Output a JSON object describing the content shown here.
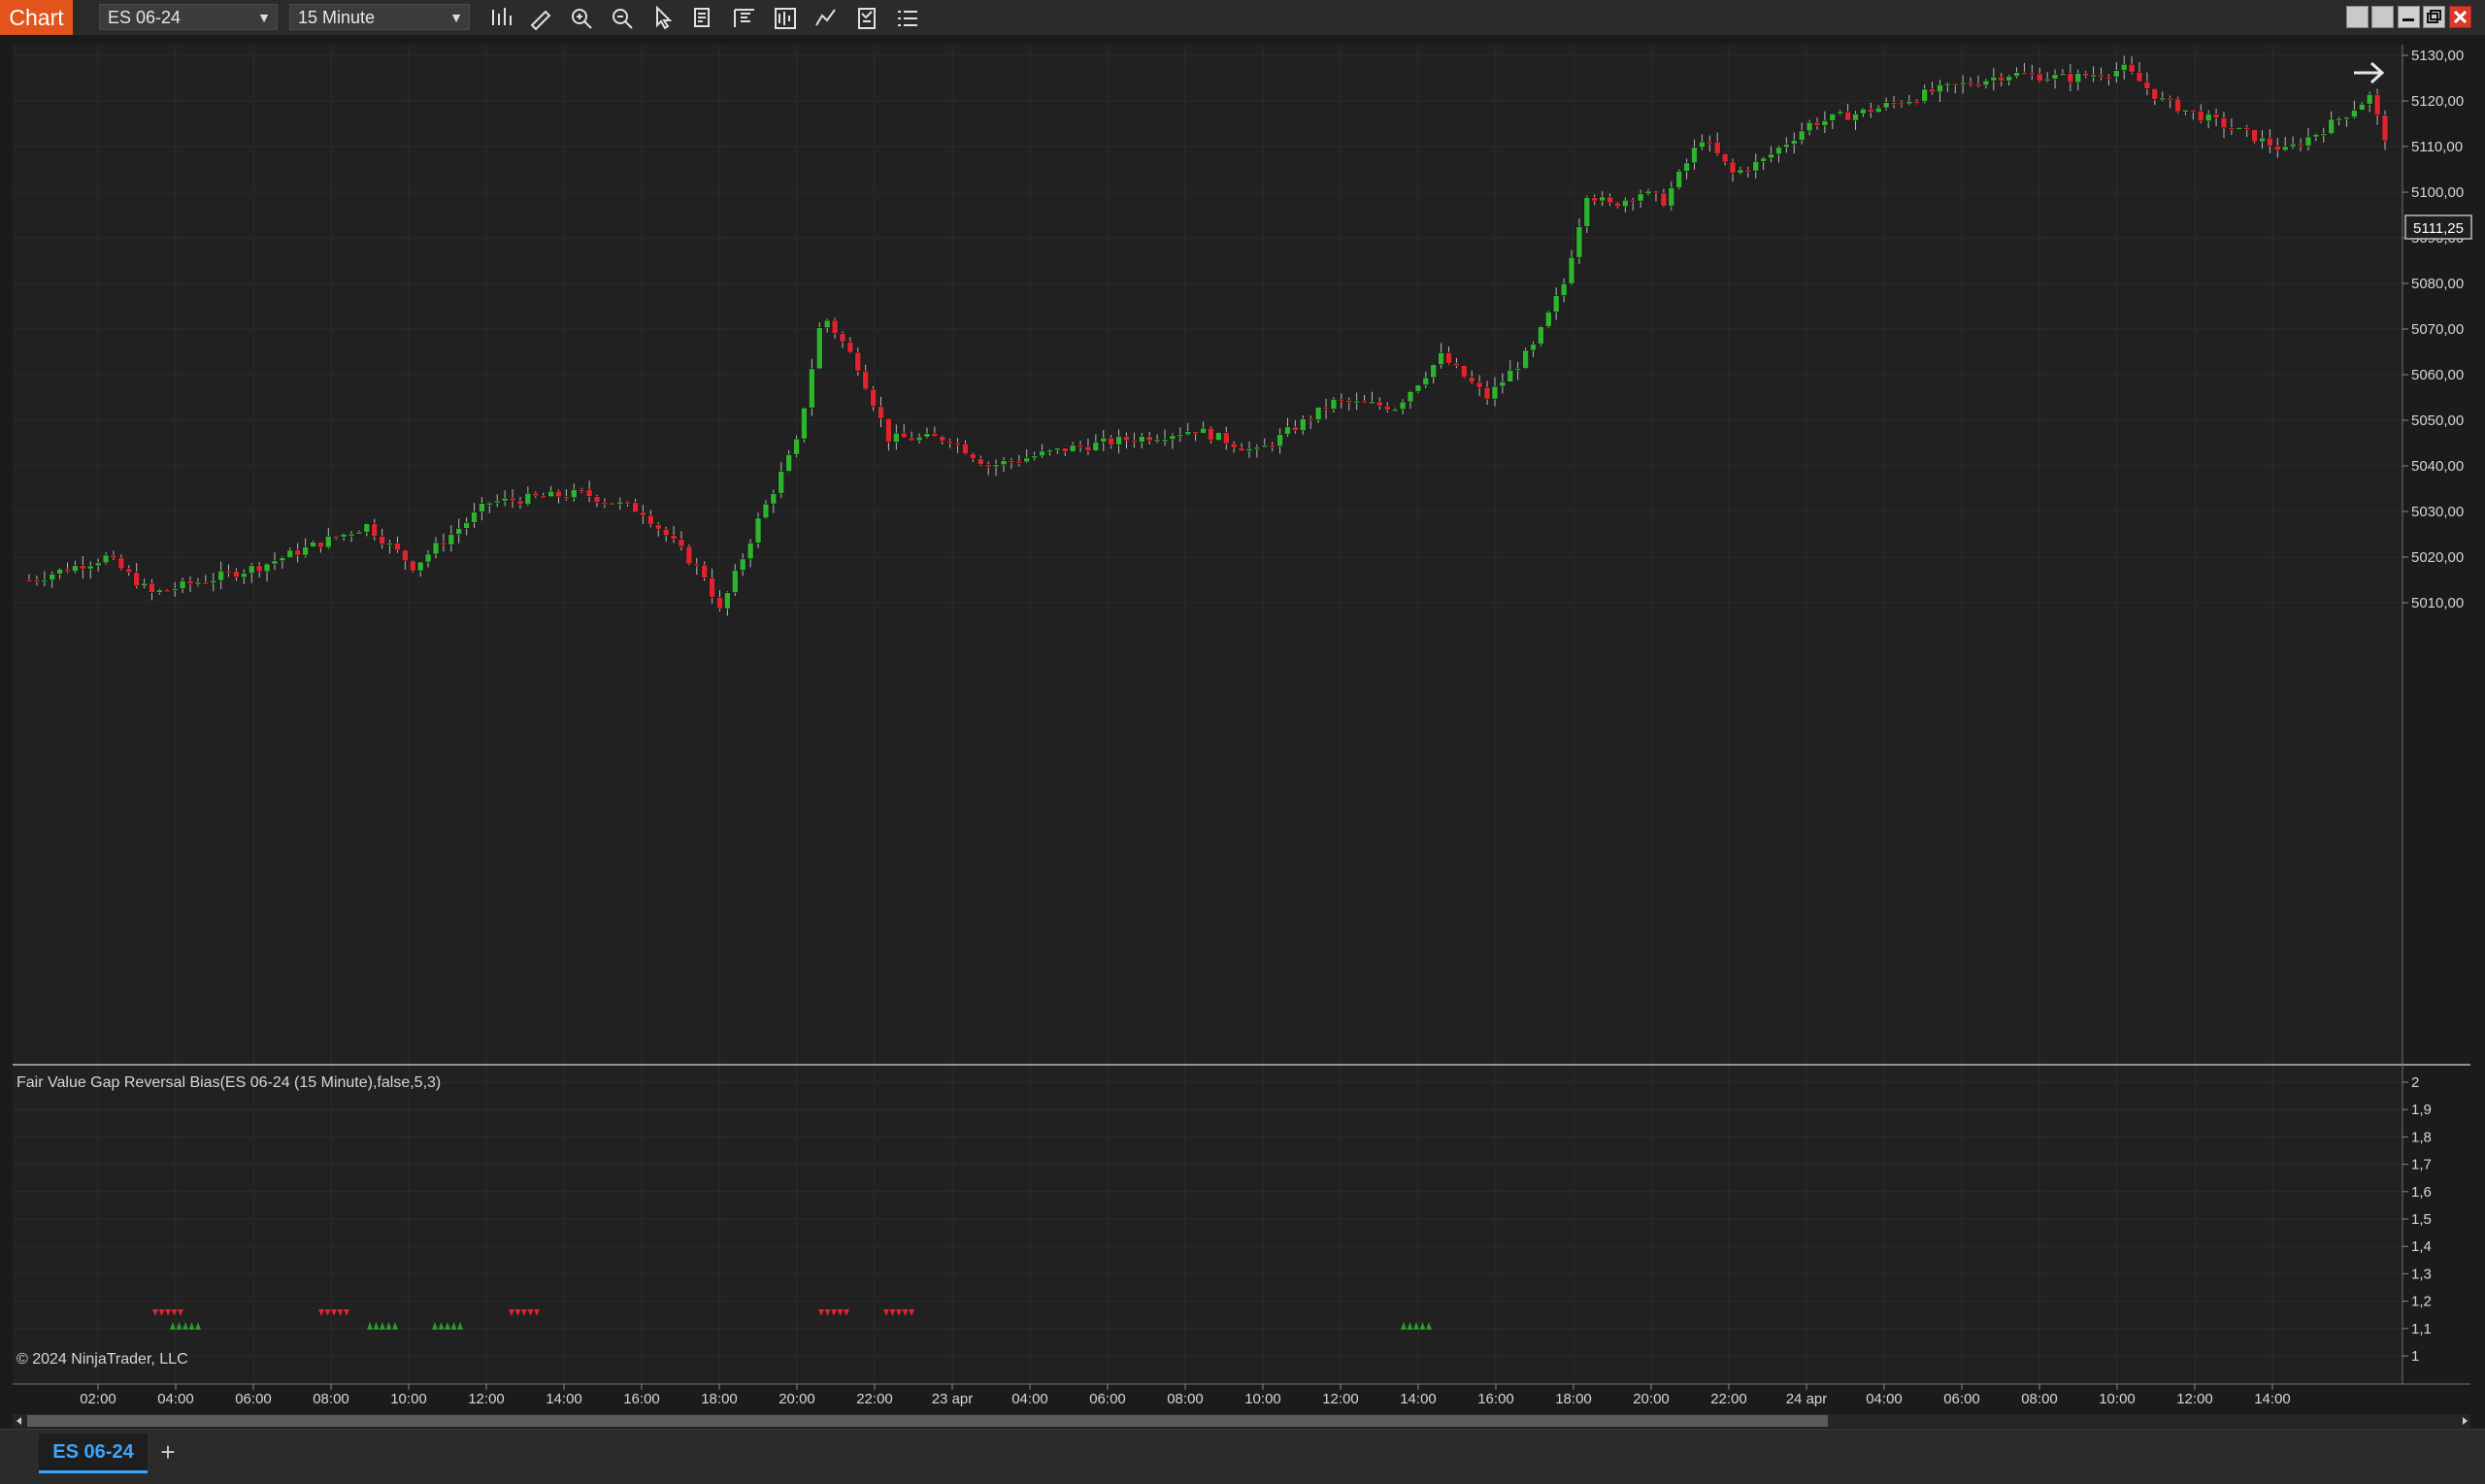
{
  "toolbar": {
    "chart_label": "Chart",
    "instrument": "ES 06-24",
    "interval": "15 Minute",
    "tools": [
      "bar-style-icon",
      "pencil-icon",
      "zoom-in-icon",
      "zoom-out-icon",
      "pointer-icon",
      "data-box-icon",
      "indicators-icon",
      "strategies-icon",
      "chart-trader-icon",
      "properties-icon",
      "list-icon"
    ]
  },
  "price_panel": {
    "current_price": "5111,25",
    "y_ticks": [
      "5130,00",
      "5120,00",
      "5110,00",
      "5100,00",
      "5090,00",
      "5080,00",
      "5070,00",
      "5060,00",
      "5050,00",
      "5040,00",
      "5030,00",
      "5020,00",
      "5010,00"
    ],
    "up_color": "#2db32d",
    "down_color": "#e0242d"
  },
  "indicator_panel": {
    "label": "Fair Value Gap Reversal Bias(ES 06-24 (15 Minute),false,5,3)",
    "copyright": "© 2024 NinjaTrader, LLC",
    "y_ticks": [
      "2",
      "1,9",
      "1,8",
      "1,7",
      "1,6",
      "1,5",
      "1,4",
      "1,3",
      "1,2",
      "1,1",
      "1"
    ],
    "signal_groups": [
      {
        "type": "down",
        "start": 157,
        "count": 5
      },
      {
        "type": "up",
        "start": 175,
        "count": 5
      },
      {
        "type": "down",
        "start": 328,
        "count": 5
      },
      {
        "type": "up",
        "start": 378,
        "count": 5
      },
      {
        "type": "up",
        "start": 445,
        "count": 5
      },
      {
        "type": "down",
        "start": 524,
        "count": 5
      },
      {
        "type": "down",
        "start": 843,
        "count": 5
      },
      {
        "type": "down",
        "start": 910,
        "count": 5
      },
      {
        "type": "up",
        "start": 1443,
        "count": 5
      }
    ]
  },
  "x_axis": {
    "labels": [
      "02:00",
      "04:00",
      "06:00",
      "08:00",
      "10:00",
      "12:00",
      "14:00",
      "16:00",
      "18:00",
      "20:00",
      "22:00",
      "23 apr",
      "04:00",
      "06:00",
      "08:00",
      "10:00",
      "12:00",
      "14:00",
      "16:00",
      "18:00",
      "20:00",
      "22:00",
      "24 apr",
      "04:00",
      "06:00",
      "08:00",
      "10:00",
      "12:00",
      "14:00"
    ]
  },
  "chart_data": {
    "type": "candlestick",
    "instrument": "ES 06-24",
    "interval": "15 Minute",
    "ylim": [
      5004,
      5135
    ],
    "key_points": [
      {
        "bar": 0,
        "price": 5015
      },
      {
        "bar": 10,
        "price": 5020
      },
      {
        "bar": 16,
        "price": 5012
      },
      {
        "bar": 30,
        "price": 5018
      },
      {
        "bar": 44,
        "price": 5027
      },
      {
        "bar": 50,
        "price": 5018
      },
      {
        "bar": 60,
        "price": 5032
      },
      {
        "bar": 72,
        "price": 5034
      },
      {
        "bar": 80,
        "price": 5030
      },
      {
        "bar": 88,
        "price": 5016
      },
      {
        "bar": 90,
        "price": 5008
      },
      {
        "bar": 95,
        "price": 5028
      },
      {
        "bar": 100,
        "price": 5045
      },
      {
        "bar": 103,
        "price": 5070
      },
      {
        "bar": 104,
        "price": 5072
      },
      {
        "bar": 108,
        "price": 5062
      },
      {
        "bar": 112,
        "price": 5046
      },
      {
        "bar": 120,
        "price": 5046
      },
      {
        "bar": 125,
        "price": 5040
      },
      {
        "bar": 136,
        "price": 5044
      },
      {
        "bar": 152,
        "price": 5048
      },
      {
        "bar": 160,
        "price": 5043
      },
      {
        "bar": 170,
        "price": 5054
      },
      {
        "bar": 178,
        "price": 5053
      },
      {
        "bar": 184,
        "price": 5064
      },
      {
        "bar": 190,
        "price": 5055
      },
      {
        "bar": 196,
        "price": 5066
      },
      {
        "bar": 200,
        "price": 5080
      },
      {
        "bar": 203,
        "price": 5100
      },
      {
        "bar": 206,
        "price": 5097
      },
      {
        "bar": 210,
        "price": 5100
      },
      {
        "bar": 213,
        "price": 5098
      },
      {
        "bar": 218,
        "price": 5112
      },
      {
        "bar": 222,
        "price": 5104
      },
      {
        "bar": 226,
        "price": 5107
      },
      {
        "bar": 232,
        "price": 5115
      },
      {
        "bar": 240,
        "price": 5118
      },
      {
        "bar": 248,
        "price": 5122
      },
      {
        "bar": 258,
        "price": 5126
      },
      {
        "bar": 266,
        "price": 5125
      },
      {
        "bar": 273,
        "price": 5127
      },
      {
        "bar": 278,
        "price": 5120
      },
      {
        "bar": 290,
        "price": 5112
      },
      {
        "bar": 294,
        "price": 5109
      },
      {
        "bar": 300,
        "price": 5115
      },
      {
        "bar": 305,
        "price": 5121
      },
      {
        "bar": 307,
        "price": 5111.25
      }
    ]
  }
}
